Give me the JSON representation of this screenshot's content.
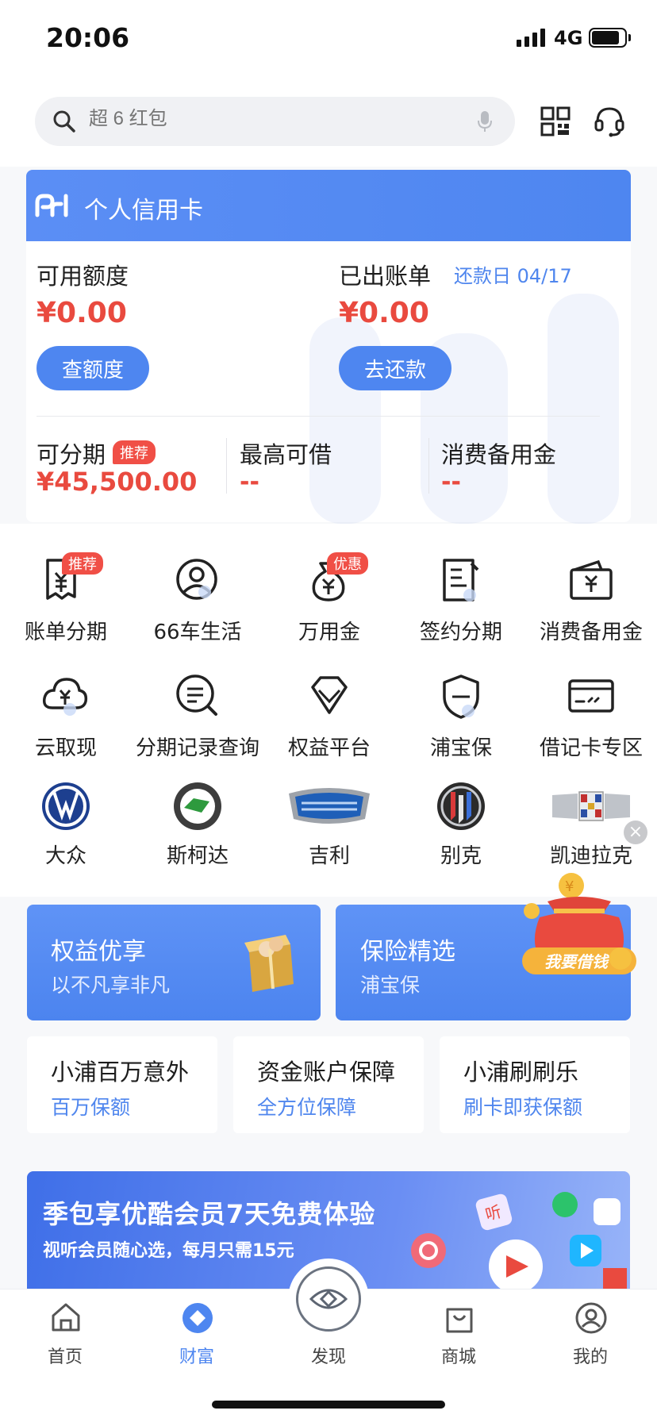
{
  "status_bar": {
    "time": "20:06",
    "network": "4G"
  },
  "search": {
    "placeholder": "超 6 红包"
  },
  "card": {
    "title": "个人信用卡",
    "available_label": "可用额度",
    "available_value": "¥0.00",
    "available_button": "查额度",
    "bill_label": "已出账单",
    "due_label": "还款日 04/17",
    "bill_value": "¥0.00",
    "bill_button": "去还款",
    "installment_label": "可分期",
    "installment_tag": "推荐",
    "installment_value": "¥45,500.00",
    "max_loan_label": "最高可借",
    "max_loan_value": "--",
    "reserve_label": "消费备用金",
    "reserve_value": "--"
  },
  "grid": {
    "row1": [
      {
        "label": "账单分期",
        "icon": "bill-installment-icon",
        "badge": "推荐"
      },
      {
        "label": "66车生活",
        "icon": "car-life-icon",
        "badge": ""
      },
      {
        "label": "万用金",
        "icon": "money-bag-icon",
        "badge": "优惠"
      },
      {
        "label": "签约分期",
        "icon": "contract-icon",
        "badge": ""
      },
      {
        "label": "消费备用金",
        "icon": "wallet-icon",
        "badge": ""
      }
    ],
    "row2": [
      {
        "label": "云取现",
        "icon": "cloud-cash-icon"
      },
      {
        "label": "分期记录查询",
        "icon": "record-search-icon"
      },
      {
        "label": "权益平台",
        "icon": "diamond-icon"
      },
      {
        "label": "浦宝保",
        "icon": "shield-icon"
      },
      {
        "label": "借记卡专区",
        "icon": "debit-card-icon"
      }
    ],
    "row3": [
      {
        "label": "大众",
        "icon": "volkswagen-logo-icon"
      },
      {
        "label": "斯柯达",
        "icon": "skoda-logo-icon"
      },
      {
        "label": "吉利",
        "icon": "geely-logo-icon"
      },
      {
        "label": "别克",
        "icon": "buick-logo-icon"
      },
      {
        "label": "凯迪拉克",
        "icon": "cadillac-logo-icon"
      }
    ]
  },
  "floating_ad": {
    "text": "我要借钱"
  },
  "promos": [
    {
      "title": "权益优享",
      "subtitle": "以不凡享非凡"
    },
    {
      "title": "保险精选",
      "subtitle": "浦宝保"
    }
  ],
  "insurance": [
    {
      "title": "小浦百万意外",
      "subtitle": "百万保额"
    },
    {
      "title": "资金账户保障",
      "subtitle": "全方位保障"
    },
    {
      "title": "小浦刷刷乐",
      "subtitle": "刷卡即获保额"
    }
  ],
  "banner": {
    "title": "季包享优酷会员7天免费体验",
    "subtitle": "视听会员随心选，每月只需15元",
    "chip": "听"
  },
  "tabbar": [
    {
      "label": "首页",
      "icon": "home-icon"
    },
    {
      "label": "财富",
      "icon": "wealth-icon"
    },
    {
      "label": "发现",
      "icon": "discover-eye-icon"
    },
    {
      "label": "商城",
      "icon": "shop-bag-icon"
    },
    {
      "label": "我的",
      "icon": "profile-icon"
    }
  ],
  "colors": {
    "accent": "#4e86f0",
    "danger": "#e94a3f",
    "badge": "#f04f46"
  }
}
